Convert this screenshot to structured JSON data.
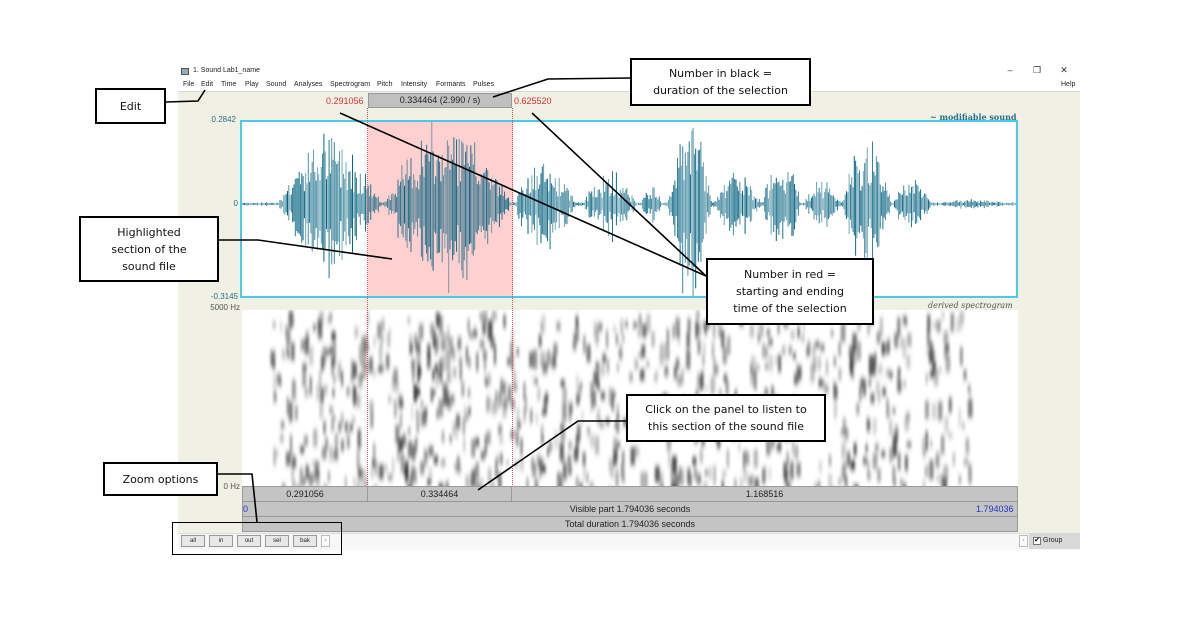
{
  "window": {
    "title": "1. Sound Lab1_name",
    "controls": {
      "minimize": "–",
      "restore": "❐",
      "close": "✕"
    },
    "menu": [
      "File",
      "Edit",
      "Time",
      "Play",
      "Sound",
      "Analyses",
      "Spectrogram",
      "Pitch",
      "Intensity",
      "Formants",
      "Pulses"
    ],
    "help": "Help"
  },
  "selection": {
    "start": "0.291056",
    "duration_label": "0.334464 (2.990 / s)",
    "end": "0.625520",
    "highlight_color": "#ffd0d0"
  },
  "waveform": {
    "amp_max": "0.2842",
    "amp_zero": "0",
    "amp_min": "-0.3145",
    "label": "~ modifiable sound",
    "color": "#00607e",
    "border_color": "#4cc8e8"
  },
  "spectrogram": {
    "freq_max": "5000 Hz",
    "freq_min": "0 Hz",
    "label": "derived spectrogram"
  },
  "time_bars": {
    "before_selection": "0.291056",
    "selection": "0.334464",
    "after_selection": "1.168516",
    "visible_start": "0",
    "visible_label": "Visible part 1.794036 seconds",
    "visible_end": "1.794036",
    "total_label": "Total duration 1.794036 seconds"
  },
  "zoom_buttons": [
    "all",
    "in",
    "out",
    "sel",
    "bak"
  ],
  "scroll": {
    "left": "‹",
    "right": "›"
  },
  "group": {
    "label": "Group",
    "checked": true,
    "check_glyph": "✔"
  },
  "annotations": {
    "edit": "Edit",
    "black_number": [
      "Number in black =",
      "duration of the selection"
    ],
    "highlighted": [
      "Highlighted",
      "section of the",
      "sound file"
    ],
    "red_number": [
      "Number in red =",
      "starting and ending",
      "time of the selection"
    ],
    "click_panel": [
      "Click on the panel to listen to",
      "this section of the sound file"
    ],
    "zoom_options": "Zoom options"
  }
}
